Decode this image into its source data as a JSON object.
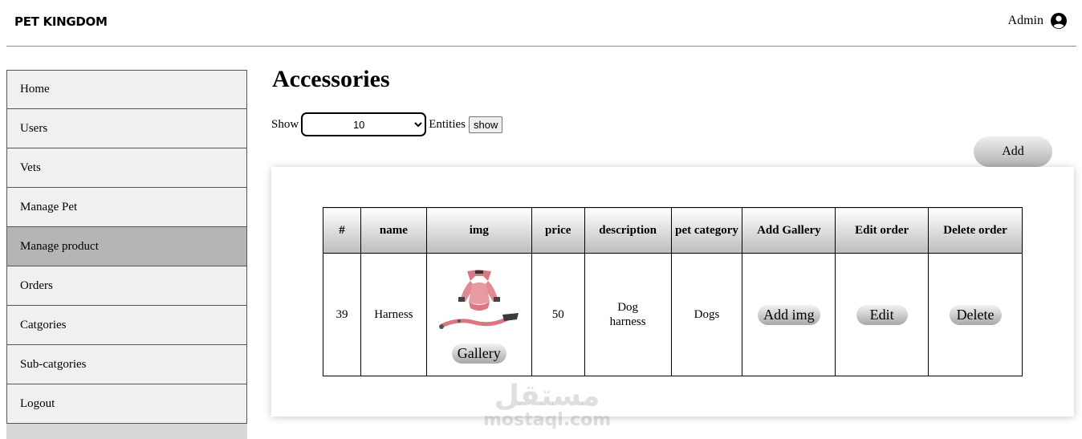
{
  "header": {
    "brand": "PET KINGDOM",
    "user_label": "Admin",
    "user_icon": "user-circle-icon"
  },
  "sidebar": {
    "items": [
      {
        "label": "Home"
      },
      {
        "label": "Users"
      },
      {
        "label": "Vets"
      },
      {
        "label": "Manage Pet"
      },
      {
        "label": "Manage product",
        "active": true
      },
      {
        "label": "Orders"
      },
      {
        "label": "Catgories"
      },
      {
        "label": "Sub-catgories"
      },
      {
        "label": "Logout"
      }
    ]
  },
  "main": {
    "title": "Accessories",
    "show_label": "Show",
    "entities_select": {
      "value": "10",
      "options": [
        "10"
      ]
    },
    "entities_label": "Entities",
    "show_button": "show",
    "add_button": "Add"
  },
  "table": {
    "headers": [
      "#",
      "name",
      "img",
      "price",
      "description",
      "pet category",
      "Add Gallery",
      "Edit order",
      "Delete order"
    ],
    "rows": [
      {
        "id": "39",
        "name": "Harness",
        "img_alt": "dog harness with leash",
        "gallery_button": "Gallery",
        "price": "50",
        "description": "Dog harness",
        "pet_category": "Dogs",
        "add_img_button": "Add img",
        "edit_button": "Edit",
        "delete_button": "Delete"
      }
    ]
  },
  "watermark": {
    "arabic": "مستقل",
    "latin": "mostaql.com"
  },
  "colors": {
    "sidebar_bg": "#f0f0f0",
    "sidebar_active": "#b5b5b5",
    "button_gradient_top": "#eeeeee",
    "button_gradient_bottom": "#b2b2b2",
    "harness_pink": "#e08a93"
  }
}
